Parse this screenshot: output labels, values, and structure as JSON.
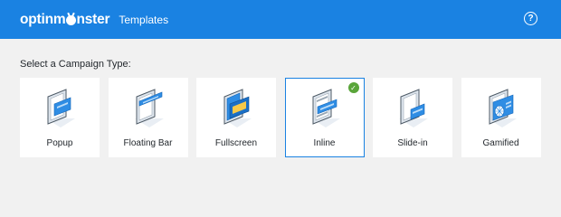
{
  "header": {
    "logo_before": "optinm",
    "logo_after": "nster",
    "title": "Templates",
    "help_icon": "question-circle-icon",
    "help_glyph": "?"
  },
  "main": {
    "section_label": "Select a Campaign Type:",
    "selected_type": "Inline",
    "types": [
      {
        "label": "Popup",
        "icon": "popup-icon"
      },
      {
        "label": "Floating Bar",
        "icon": "floating-bar-icon"
      },
      {
        "label": "Fullscreen",
        "icon": "fullscreen-icon"
      },
      {
        "label": "Inline",
        "icon": "inline-icon"
      },
      {
        "label": "Slide-in",
        "icon": "slide-in-icon"
      },
      {
        "label": "Gamified",
        "icon": "gamified-icon"
      }
    ]
  },
  "colors": {
    "brand_blue": "#1a82e2",
    "check_green": "#5aa53a",
    "background": "#f1f1f1"
  }
}
